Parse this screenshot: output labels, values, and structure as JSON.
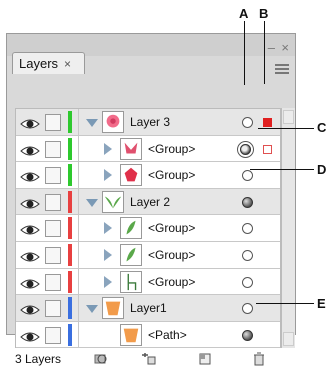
{
  "callouts": [
    "A",
    "B",
    "C",
    "D",
    "E"
  ],
  "panel": {
    "tab_label": "Layers",
    "tab_close": "×",
    "minimize": "–",
    "close": "×"
  },
  "rows": [
    {
      "name": "Layer 3",
      "kind": "layer",
      "color": "#2ec92e",
      "thumb": "rose-flower",
      "target": "empty",
      "selection_square": "#e02020"
    },
    {
      "name": "<Group>",
      "kind": "group",
      "color": "#2ec92e",
      "thumb": "pink-tulip",
      "target": "ring",
      "selection_square": "#e05050"
    },
    {
      "name": "<Group>",
      "kind": "group",
      "color": "#2ec92e",
      "thumb": "red-flower",
      "target": "empty"
    },
    {
      "name": "Layer 2",
      "kind": "layer",
      "color": "#e84040",
      "thumb": "green-leaves",
      "target": "filled"
    },
    {
      "name": "<Group>",
      "kind": "group",
      "color": "#e84040",
      "thumb": "leaf",
      "target": "empty"
    },
    {
      "name": "<Group>",
      "kind": "group",
      "color": "#e84040",
      "thumb": "leaf",
      "target": "empty"
    },
    {
      "name": "<Group>",
      "kind": "group",
      "color": "#e84040",
      "thumb": "stem",
      "target": "empty"
    },
    {
      "name": "Layer1",
      "kind": "layer",
      "color": "#3a6fe0",
      "thumb": "orange-pot",
      "target": "empty"
    },
    {
      "name": "<Path>",
      "kind": "path",
      "color": "#3a6fe0",
      "thumb": "orange-pot",
      "target": "filled"
    }
  ],
  "footer": {
    "count_label": "3 Layers",
    "icons": [
      "make-clipping-mask-icon",
      "create-sublayer-icon",
      "new-layer-icon",
      "delete-icon"
    ]
  }
}
